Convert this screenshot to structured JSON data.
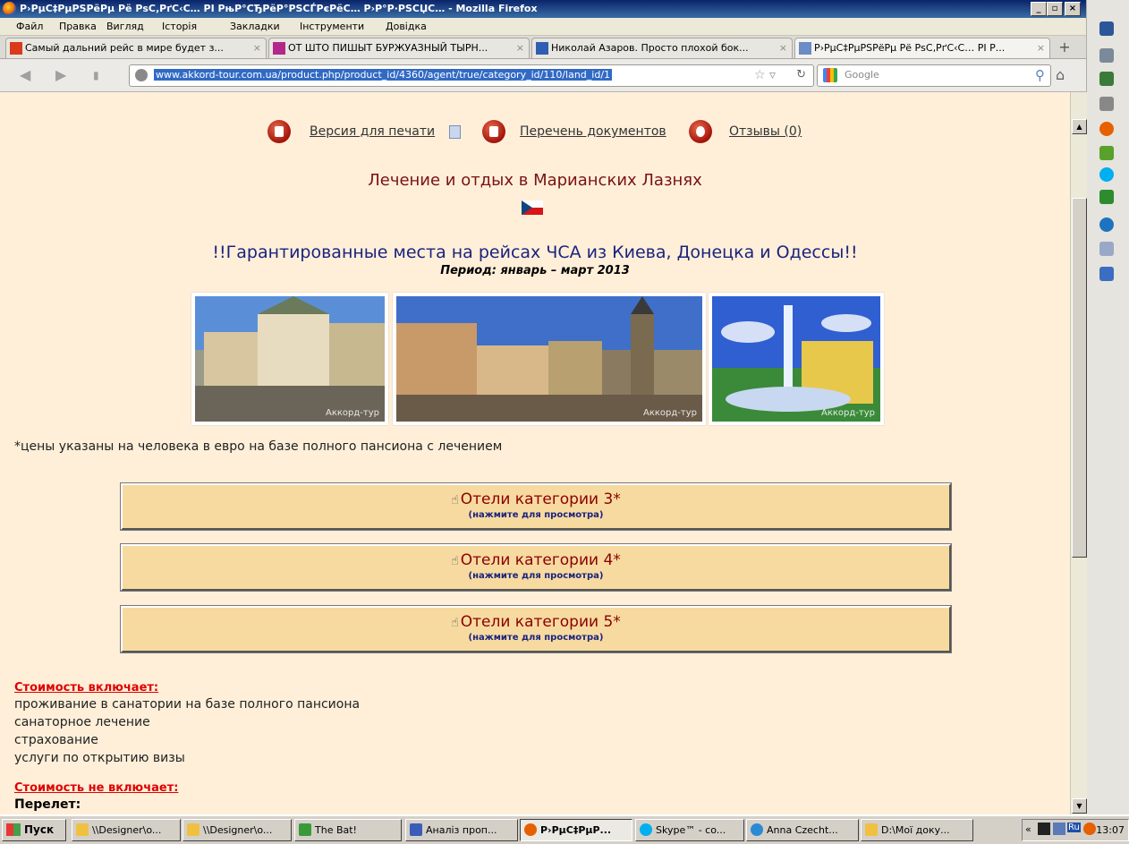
{
  "window": {
    "title": "Р›РµС‡РµРЅРёРµ Рё РѕС‚РґС‹С… РІ Р№Р°СЂРёР°РЅСЃРєРёС… Р›Р°Р·РЅСЏС… - Mozilla Firefox",
    "title_display": "Р›РµС‡РµРЅРёРµ Рё РѕС‚РґС‹С… РІ РњР°СЂРёР°РЅСЃРєРёС… Р›Р°Р·РЅСЏС… - Mozilla Firefox"
  },
  "menu": [
    "Файл",
    "Правка",
    "Вигляд",
    "Історія",
    "Закладки",
    "Інструменти",
    "Довідка"
  ],
  "tabs": [
    {
      "label": "Самый дальний рейс в мире будет з...",
      "icon_color": "#d93a1a"
    },
    {
      "label": "ОТ ШТО ПИШЫТ БУРЖУАЗНЫЙ ТЫРН...",
      "icon_color": "#b3278a"
    },
    {
      "label": "Николай Азаров. Просто плохой бок...",
      "icon_color": "#2e5fb3"
    },
    {
      "label": "Р›РµС‡РµРЅРёРµ Рё РѕС‚РґС‹С… РІ Р...",
      "icon_color": "#6b8cc4"
    }
  ],
  "address": {
    "url": "www.akkord-tour.com.ua/product.php/product_id/4360/agent/true/category_id/110/land_id/1"
  },
  "search": {
    "placeholder": "Google"
  },
  "page": {
    "links": {
      "print": "Версия для печати",
      "docs": "Перечень документов",
      "reviews": "Отзывы (0)"
    },
    "title": "Лечение и отдых в Марианских Лазнях",
    "headline": "!!Гарантированные места на рейсах ЧСА из Киева, Донецка и Одессы!!",
    "period": "Период: январь – март 2013",
    "photo_watermark": "Аккорд-тур",
    "price_note": "*цены указаны на человека в евро на базе полного пансиона с лечением",
    "hotel_buttons": [
      {
        "title": "Отели категории 3*",
        "sub": "(нажмите для просмотра)"
      },
      {
        "title": "Отели категории 4*",
        "sub": "(нажмите для просмотра)"
      },
      {
        "title": "Отели категории 5*",
        "sub": "(нажмите для просмотра)"
      }
    ],
    "includes_title": "Стоимость включает:",
    "includes": [
      "проживание в санатории на базе полного пансиона",
      "санаторное лечение",
      "страхование",
      "услуги по открытию визы"
    ],
    "excludes_title": "Стоимость не включает:",
    "flight_label": "Перелет:"
  },
  "taskbar": {
    "start": "Пуск",
    "items": [
      {
        "label": "\\\\Designer\\o...",
        "icon_color": "#f0c040"
      },
      {
        "label": "\\\\Designer\\o...",
        "icon_color": "#f0c040"
      },
      {
        "label": "The Bat!",
        "icon_color": "#3a9a3a"
      },
      {
        "label": "Аналіз проп...",
        "icon_color": "#3b5cb8"
      },
      {
        "label": "Р›РµС‡РµР...",
        "icon_color": "#e66000"
      },
      {
        "label": "Skype™ - co...",
        "icon_color": "#00aff0"
      },
      {
        "label": "Anna Czecht...",
        "icon_color": "#2a8ad4"
      },
      {
        "label": "D:\\Мої доку...",
        "icon_color": "#f0c040"
      }
    ],
    "tray_lang": "Ru",
    "clock": "13:07"
  }
}
